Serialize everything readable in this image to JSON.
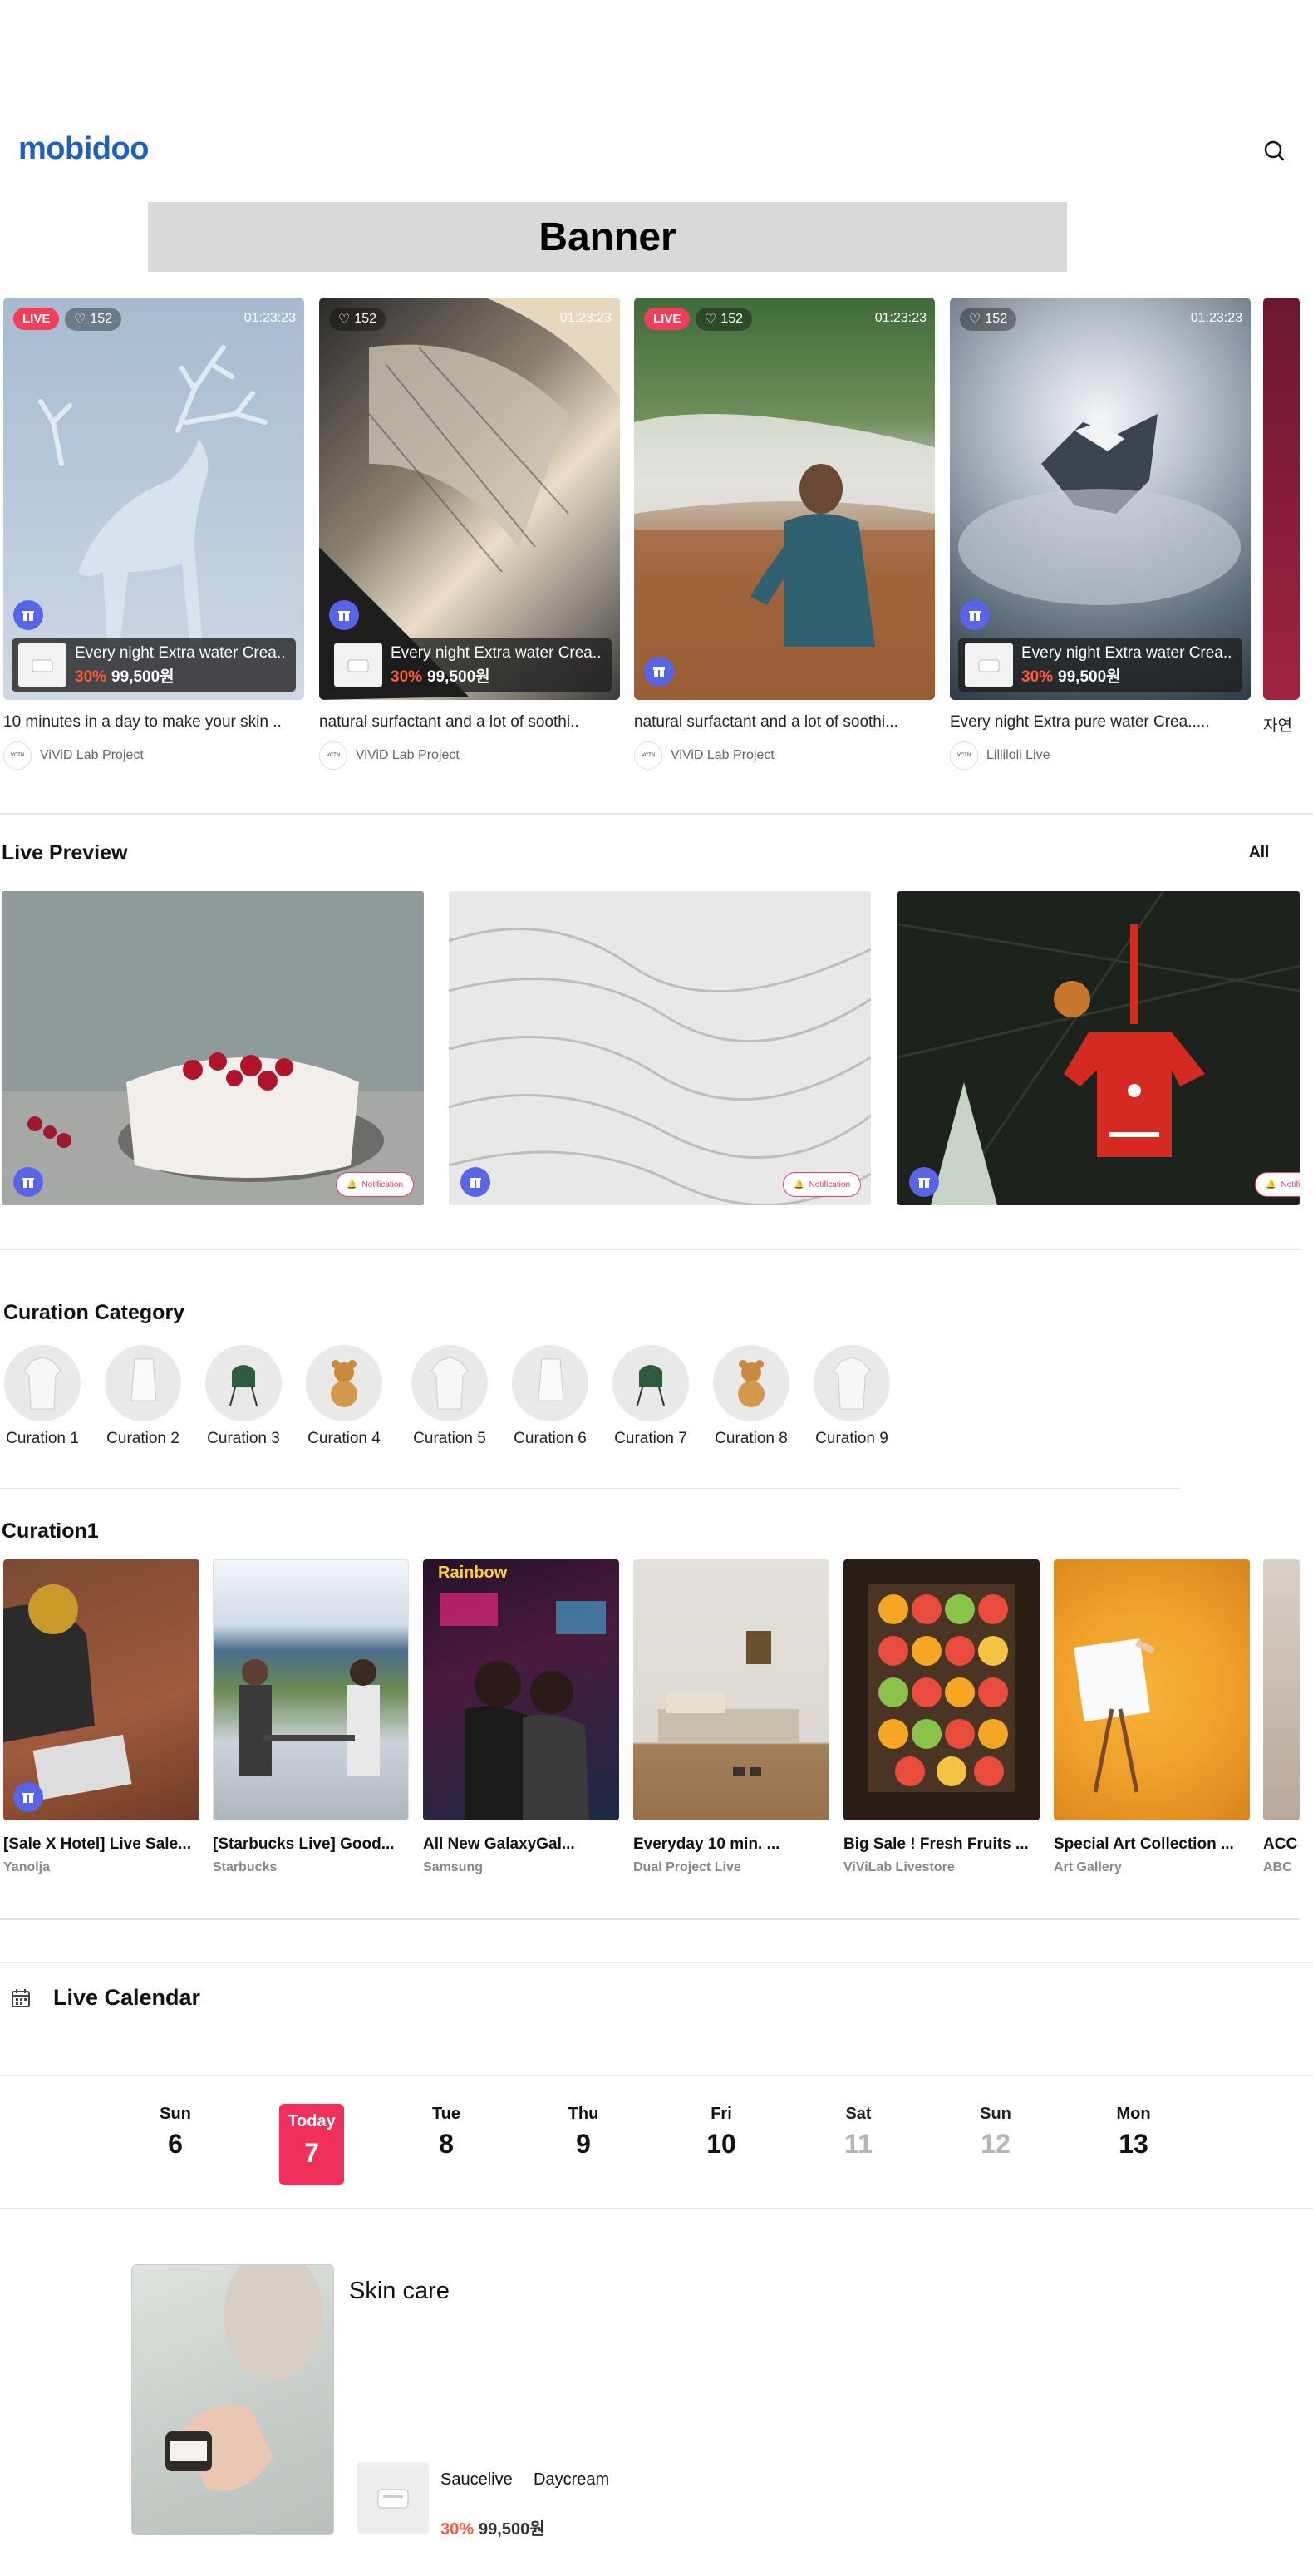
{
  "app": {
    "logo": "mobidoo"
  },
  "banner": {
    "label": "Banner"
  },
  "live_cards": [
    {
      "live_badge": "LIVE",
      "likes": "152",
      "timer": "01:23:23",
      "overlay_title": "Every night Extra water Crea..",
      "discount": "30%",
      "price": "99,500원",
      "title": "10 minutes in a day to make your skin ..",
      "seller": "ViViD Lab Project"
    },
    {
      "live_badge": "",
      "likes": "152",
      "timer": "01:23:23",
      "overlay_title": "Every night Extra water Crea..",
      "discount": "30%",
      "price": "99,500원",
      "title": "natural surfactant and a lot of soothi..",
      "seller": "ViViD Lab Project"
    },
    {
      "live_badge": "LIVE",
      "likes": "152",
      "timer": "01:23:23",
      "overlay_title": "",
      "discount": "",
      "price": "",
      "title": "natural surfactant and a lot of soothi...",
      "seller": "ViViD Lab Project"
    },
    {
      "live_badge": "",
      "likes": "152",
      "timer": "01:23:23",
      "overlay_title": "Every night Extra water Crea..",
      "discount": "30%",
      "price": "99,500원",
      "title": "Every night Extra pure water Crea.....",
      "seller": "Lilliloli Live"
    },
    {
      "title": "자연"
    }
  ],
  "live_preview": {
    "title": "Live Preview",
    "all_label": "All",
    "items": [
      {
        "notification_label": "Notification"
      },
      {
        "notification_label": "Notification"
      },
      {
        "notification_label": "Notification"
      }
    ]
  },
  "curation_category": {
    "title": "Curation Category",
    "items": [
      "Curation 1",
      "Curation 2",
      "Curation 3",
      "Curation 4",
      "Curation 5",
      "Curation 6",
      "Curation 7",
      "Curation 8",
      "Curation 9"
    ]
  },
  "curation1": {
    "title": "Curation1",
    "items": [
      {
        "title": "[Sale X Hotel] Live Sale...",
        "seller": "Yanolja"
      },
      {
        "title": "[Starbucks Live] Good...",
        "seller": "Starbucks"
      },
      {
        "title": "All New GalaxyGal...",
        "seller": "Samsung"
      },
      {
        "title": "Everyday 10 min. ...",
        "seller": "Dual Project Live"
      },
      {
        "title": "Big Sale ! Fresh Fruits ...",
        "seller": "ViViLab Livestore"
      },
      {
        "title": "Special Art Collection ...",
        "seller": "Art Gallery"
      },
      {
        "title": "ACC",
        "seller": "ABC"
      }
    ]
  },
  "live_calendar": {
    "title": "Live Calendar",
    "days": [
      {
        "name": "Sun",
        "num": "6"
      },
      {
        "name": "Today",
        "num": "7"
      },
      {
        "name": "Tue",
        "num": "8"
      },
      {
        "name": "Thu",
        "num": "9"
      },
      {
        "name": "Fri",
        "num": "10"
      },
      {
        "name": "Sat",
        "num": "11"
      },
      {
        "name": "Sun",
        "num": "12"
      },
      {
        "name": "Mon",
        "num": "13"
      }
    ],
    "schedule": {
      "title": "Skin care",
      "seller": "Saucelive",
      "category": "Daycream",
      "discount": "30%",
      "price": "99,500원"
    }
  },
  "colors": {
    "brand": "#1f5fbf",
    "live_red": "#f03e5b",
    "discount": "#ff5a36",
    "gift": "#5865e6"
  }
}
